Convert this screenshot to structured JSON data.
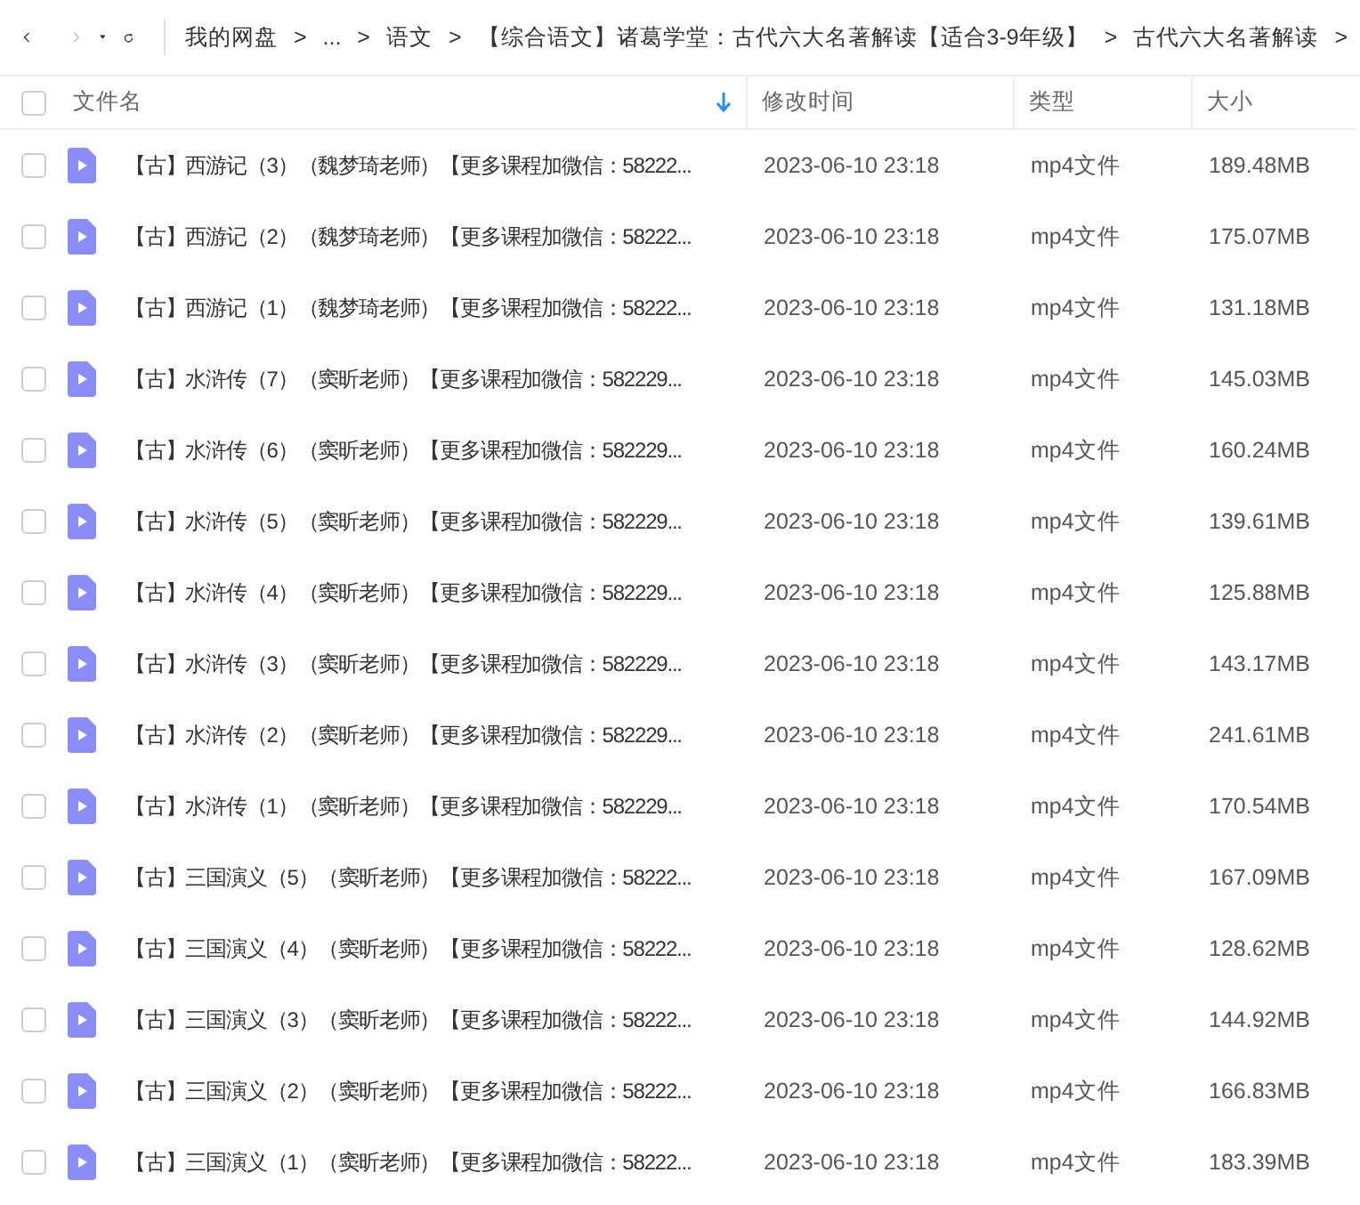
{
  "breadcrumb": [
    {
      "label": "我的网盘",
      "separator": ">"
    },
    {
      "label": "...",
      "separator": ">"
    },
    {
      "label": "语文",
      "separator": ">"
    },
    {
      "label": "【综合语文】诸葛学堂：古代六大名著解读【适合3-9年级】",
      "separator": ">"
    },
    {
      "label": "古代六大名著解读",
      "separator": ">"
    }
  ],
  "table": {
    "select_all_checked": false,
    "columns": [
      {
        "label": "文件名",
        "sorted": true
      },
      {
        "label": "修改时间",
        "sorted": false
      },
      {
        "label": "类型",
        "sorted": false
      },
      {
        "label": "大小",
        "sorted": false
      }
    ],
    "rows": [
      {
        "checked": false,
        "name": "【古】西游记（3）（魏梦琦老师）【更多课程加微信：58222...",
        "modified": "2023-06-10 23:18",
        "type": "mp4文件",
        "size": "189.48MB"
      },
      {
        "checked": false,
        "name": "【古】西游记（2）（魏梦琦老师）【更多课程加微信：58222...",
        "modified": "2023-06-10 23:18",
        "type": "mp4文件",
        "size": "175.07MB"
      },
      {
        "checked": false,
        "name": "【古】西游记（1）（魏梦琦老师）【更多课程加微信：58222...",
        "modified": "2023-06-10 23:18",
        "type": "mp4文件",
        "size": "131.18MB"
      },
      {
        "checked": false,
        "name": "【古】水浒传（7）（窦昕老师）【更多课程加微信：582229...",
        "modified": "2023-06-10 23:18",
        "type": "mp4文件",
        "size": "145.03MB"
      },
      {
        "checked": false,
        "name": "【古】水浒传（6）（窦昕老师）【更多课程加微信：582229...",
        "modified": "2023-06-10 23:18",
        "type": "mp4文件",
        "size": "160.24MB"
      },
      {
        "checked": false,
        "name": "【古】水浒传（5）（窦昕老师）【更多课程加微信：582229...",
        "modified": "2023-06-10 23:18",
        "type": "mp4文件",
        "size": "139.61MB"
      },
      {
        "checked": false,
        "name": "【古】水浒传（4）（窦昕老师）【更多课程加微信：582229...",
        "modified": "2023-06-10 23:18",
        "type": "mp4文件",
        "size": "125.88MB"
      },
      {
        "checked": false,
        "name": "【古】水浒传（3）（窦昕老师）【更多课程加微信：582229...",
        "modified": "2023-06-10 23:18",
        "type": "mp4文件",
        "size": "143.17MB"
      },
      {
        "checked": false,
        "name": "【古】水浒传（2）（窦昕老师）【更多课程加微信：582229...",
        "modified": "2023-06-10 23:18",
        "type": "mp4文件",
        "size": "241.61MB"
      },
      {
        "checked": false,
        "name": "【古】水浒传（1）（窦昕老师）【更多课程加微信：582229...",
        "modified": "2023-06-10 23:18",
        "type": "mp4文件",
        "size": "170.54MB"
      },
      {
        "checked": false,
        "name": "【古】三国演义（5）（窦昕老师）【更多课程加微信：58222...",
        "modified": "2023-06-10 23:18",
        "type": "mp4文件",
        "size": "167.09MB"
      },
      {
        "checked": false,
        "name": "【古】三国演义（4）（窦昕老师）【更多课程加微信：58222...",
        "modified": "2023-06-10 23:18",
        "type": "mp4文件",
        "size": "128.62MB"
      },
      {
        "checked": false,
        "name": "【古】三国演义（3）（窦昕老师）【更多课程加微信：58222...",
        "modified": "2023-06-10 23:18",
        "type": "mp4文件",
        "size": "144.92MB"
      },
      {
        "checked": false,
        "name": "【古】三国演义（2）（窦昕老师）【更多课程加微信：58222...",
        "modified": "2023-06-10 23:18",
        "type": "mp4文件",
        "size": "166.83MB"
      },
      {
        "checked": false,
        "name": "【古】三国演义（1）（窦昕老师）【更多课程加微信：58222...",
        "modified": "2023-06-10 23:18",
        "type": "mp4文件",
        "size": "183.39MB"
      }
    ]
  }
}
